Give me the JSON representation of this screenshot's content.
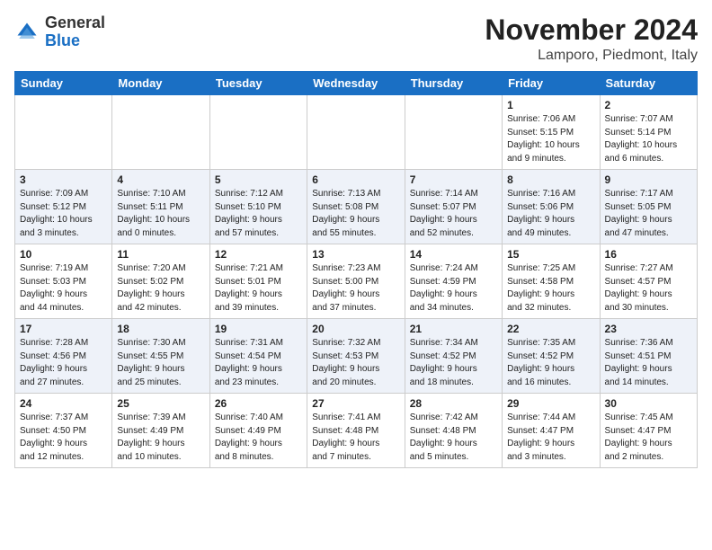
{
  "header": {
    "logo_general": "General",
    "logo_blue": "Blue",
    "month_title": "November 2024",
    "location": "Lamporo, Piedmont, Italy"
  },
  "weekdays": [
    "Sunday",
    "Monday",
    "Tuesday",
    "Wednesday",
    "Thursday",
    "Friday",
    "Saturday"
  ],
  "weeks": [
    [
      {
        "day": "",
        "info": ""
      },
      {
        "day": "",
        "info": ""
      },
      {
        "day": "",
        "info": ""
      },
      {
        "day": "",
        "info": ""
      },
      {
        "day": "",
        "info": ""
      },
      {
        "day": "1",
        "info": "Sunrise: 7:06 AM\nSunset: 5:15 PM\nDaylight: 10 hours\nand 9 minutes."
      },
      {
        "day": "2",
        "info": "Sunrise: 7:07 AM\nSunset: 5:14 PM\nDaylight: 10 hours\nand 6 minutes."
      }
    ],
    [
      {
        "day": "3",
        "info": "Sunrise: 7:09 AM\nSunset: 5:12 PM\nDaylight: 10 hours\nand 3 minutes."
      },
      {
        "day": "4",
        "info": "Sunrise: 7:10 AM\nSunset: 5:11 PM\nDaylight: 10 hours\nand 0 minutes."
      },
      {
        "day": "5",
        "info": "Sunrise: 7:12 AM\nSunset: 5:10 PM\nDaylight: 9 hours\nand 57 minutes."
      },
      {
        "day": "6",
        "info": "Sunrise: 7:13 AM\nSunset: 5:08 PM\nDaylight: 9 hours\nand 55 minutes."
      },
      {
        "day": "7",
        "info": "Sunrise: 7:14 AM\nSunset: 5:07 PM\nDaylight: 9 hours\nand 52 minutes."
      },
      {
        "day": "8",
        "info": "Sunrise: 7:16 AM\nSunset: 5:06 PM\nDaylight: 9 hours\nand 49 minutes."
      },
      {
        "day": "9",
        "info": "Sunrise: 7:17 AM\nSunset: 5:05 PM\nDaylight: 9 hours\nand 47 minutes."
      }
    ],
    [
      {
        "day": "10",
        "info": "Sunrise: 7:19 AM\nSunset: 5:03 PM\nDaylight: 9 hours\nand 44 minutes."
      },
      {
        "day": "11",
        "info": "Sunrise: 7:20 AM\nSunset: 5:02 PM\nDaylight: 9 hours\nand 42 minutes."
      },
      {
        "day": "12",
        "info": "Sunrise: 7:21 AM\nSunset: 5:01 PM\nDaylight: 9 hours\nand 39 minutes."
      },
      {
        "day": "13",
        "info": "Sunrise: 7:23 AM\nSunset: 5:00 PM\nDaylight: 9 hours\nand 37 minutes."
      },
      {
        "day": "14",
        "info": "Sunrise: 7:24 AM\nSunset: 4:59 PM\nDaylight: 9 hours\nand 34 minutes."
      },
      {
        "day": "15",
        "info": "Sunrise: 7:25 AM\nSunset: 4:58 PM\nDaylight: 9 hours\nand 32 minutes."
      },
      {
        "day": "16",
        "info": "Sunrise: 7:27 AM\nSunset: 4:57 PM\nDaylight: 9 hours\nand 30 minutes."
      }
    ],
    [
      {
        "day": "17",
        "info": "Sunrise: 7:28 AM\nSunset: 4:56 PM\nDaylight: 9 hours\nand 27 minutes."
      },
      {
        "day": "18",
        "info": "Sunrise: 7:30 AM\nSunset: 4:55 PM\nDaylight: 9 hours\nand 25 minutes."
      },
      {
        "day": "19",
        "info": "Sunrise: 7:31 AM\nSunset: 4:54 PM\nDaylight: 9 hours\nand 23 minutes."
      },
      {
        "day": "20",
        "info": "Sunrise: 7:32 AM\nSunset: 4:53 PM\nDaylight: 9 hours\nand 20 minutes."
      },
      {
        "day": "21",
        "info": "Sunrise: 7:34 AM\nSunset: 4:52 PM\nDaylight: 9 hours\nand 18 minutes."
      },
      {
        "day": "22",
        "info": "Sunrise: 7:35 AM\nSunset: 4:52 PM\nDaylight: 9 hours\nand 16 minutes."
      },
      {
        "day": "23",
        "info": "Sunrise: 7:36 AM\nSunset: 4:51 PM\nDaylight: 9 hours\nand 14 minutes."
      }
    ],
    [
      {
        "day": "24",
        "info": "Sunrise: 7:37 AM\nSunset: 4:50 PM\nDaylight: 9 hours\nand 12 minutes."
      },
      {
        "day": "25",
        "info": "Sunrise: 7:39 AM\nSunset: 4:49 PM\nDaylight: 9 hours\nand 10 minutes."
      },
      {
        "day": "26",
        "info": "Sunrise: 7:40 AM\nSunset: 4:49 PM\nDaylight: 9 hours\nand 8 minutes."
      },
      {
        "day": "27",
        "info": "Sunrise: 7:41 AM\nSunset: 4:48 PM\nDaylight: 9 hours\nand 7 minutes."
      },
      {
        "day": "28",
        "info": "Sunrise: 7:42 AM\nSunset: 4:48 PM\nDaylight: 9 hours\nand 5 minutes."
      },
      {
        "day": "29",
        "info": "Sunrise: 7:44 AM\nSunset: 4:47 PM\nDaylight: 9 hours\nand 3 minutes."
      },
      {
        "day": "30",
        "info": "Sunrise: 7:45 AM\nSunset: 4:47 PM\nDaylight: 9 hours\nand 2 minutes."
      }
    ]
  ]
}
